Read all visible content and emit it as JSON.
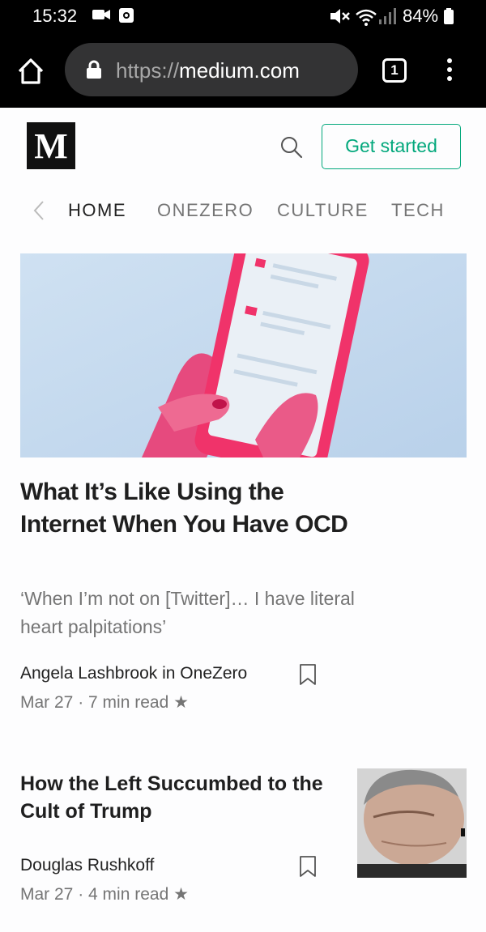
{
  "status_bar": {
    "time": "15:32",
    "battery": "84%",
    "icons": [
      "video-icon",
      "screen-record-icon",
      "mute-icon",
      "wifi-icon",
      "signal-icon",
      "battery-icon"
    ]
  },
  "browser": {
    "url_scheme": "https://",
    "url_host": "medium.com",
    "tab_count": "1"
  },
  "header": {
    "logo": "M",
    "cta": "Get started"
  },
  "nav": {
    "items": [
      "HOME",
      "ONEZERO",
      "CULTURE",
      "TECH"
    ],
    "active": "HOME"
  },
  "articles": [
    {
      "title": "What It’s Like Using the Internet When You Have OCD",
      "subtitle": "‘When I’m not on [Twitter]… I have literal heart palpitations’",
      "author": "Angela Lashbrook in OneZero",
      "date": "Mar 27",
      "read_time": "7 min read",
      "star": "★"
    },
    {
      "title": "How the Left Succumbed to the Cult of Trump",
      "author": "Douglas Rushkoff",
      "date": "Mar 27",
      "read_time": "4 min read",
      "star": "★"
    }
  ],
  "colors": {
    "brand_green": "#03a87c",
    "hero_pink": "#f0336a",
    "hero_blue": "#c3d9ee"
  }
}
